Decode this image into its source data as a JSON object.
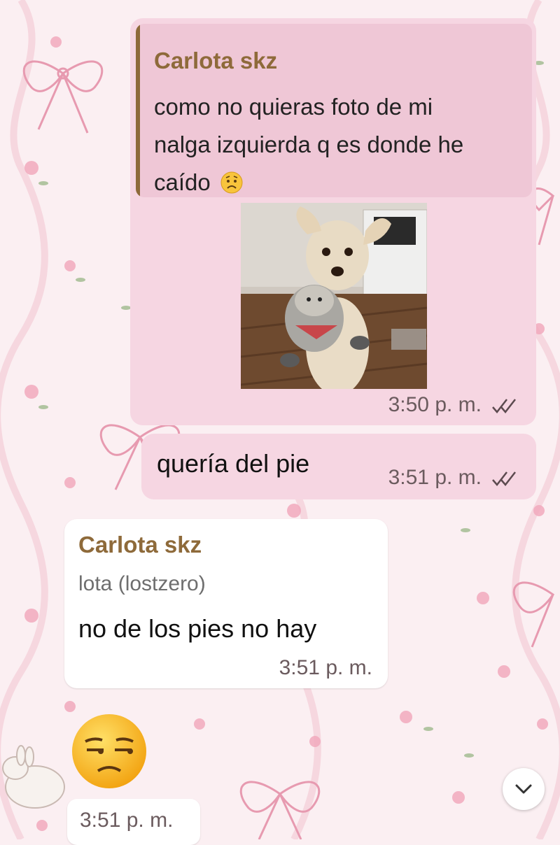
{
  "messages": [
    {
      "quote": {
        "sender": "Carlota skz",
        "lines": [
          "como no quieras foto de mi",
          "nalga izquierda q es donde he",
          "caído"
        ],
        "emoji": "worried-face"
      },
      "image": "dog-holding-plush-toy",
      "time": "3:50 p. m.",
      "status": "read-double-check"
    },
    {
      "text": "quería del pie",
      "time": "3:51 p. m.",
      "status": "read-double-check"
    },
    {
      "sender": "Carlota skz",
      "author": "lota (lostzero)",
      "text": "no de los pies no hay",
      "time": "3:51 p. m."
    },
    {
      "emoji": "unamused-face",
      "time": "3:51 p. m."
    }
  ],
  "scroll_down_icon": "chevron-down-icon",
  "colors": {
    "outgoing_bubble": "#f6d6e2",
    "quote_background": "#efc7d6",
    "sender_name": "#8e6a3a",
    "read_ticks": "#5c4a4f",
    "wallpaper": "#fbeff2"
  }
}
